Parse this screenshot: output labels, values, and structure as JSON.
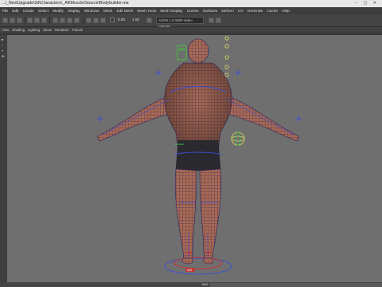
{
  "window": {
    "title": "...\\_NextUpgrade\\3d\\Characters\\_All\\Muscle\\Source\\Bodybuilder.ma",
    "controls": "– ▢ ✕"
  },
  "menubar": {
    "items": [
      "File",
      "Edit",
      "Create",
      "Select",
      "Modify",
      "Display",
      "Windows",
      "Mesh",
      "Edit Mesh",
      "Mesh Tools",
      "Mesh Display",
      "Curves",
      "Surfaces",
      "Deform",
      "UV",
      "Generate",
      "Cache",
      "Help"
    ]
  },
  "statusline": {
    "readout_left": "0.00",
    "readout_right": "1.00",
    "colorspace": "ACES 1.0 SDR-video (sRGB)"
  },
  "panel_menu": {
    "items": [
      "View",
      "Shading",
      "Lighting",
      "Show",
      "Renderer",
      "Panels"
    ]
  },
  "helpline": {
    "mel_label": "MEL"
  },
  "viewport": {
    "background": "#6f6f6f",
    "wire_color": "#2b2060",
    "skin_color": "#a86a52",
    "shorts_color": "#2a2a2a",
    "controller_blue": "#3a4fd6",
    "controller_yellow": "#d8d860",
    "controller_green": "#40c040",
    "controller_red": "#d03030",
    "selected_label": "root"
  },
  "leftbar": {
    "items": [
      "arrow-select-icon",
      "lasso-icon",
      "paint-select-icon",
      "move-icon"
    ]
  }
}
